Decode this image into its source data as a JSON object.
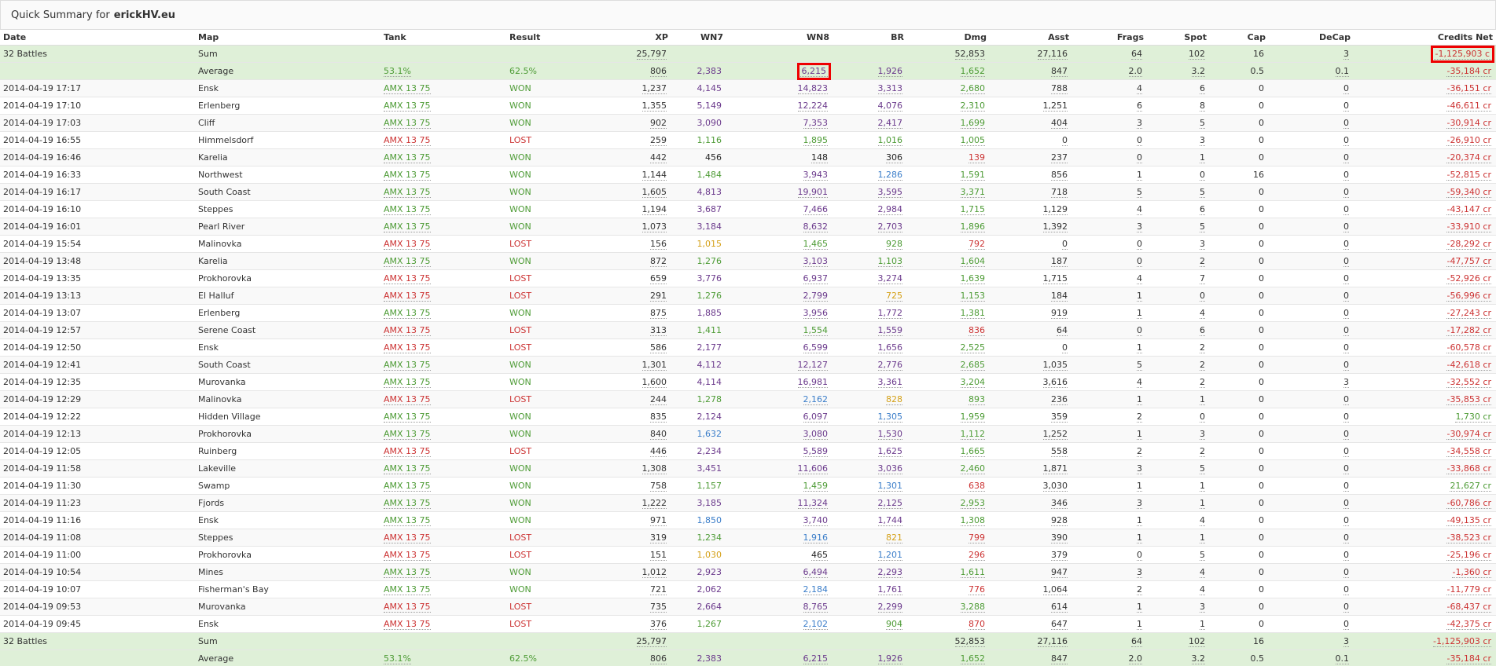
{
  "header": {
    "title_prefix": "Quick Summary for",
    "player": "erickHV.eu"
  },
  "columns": [
    "Date",
    "Map",
    "Tank",
    "Result",
    "XP",
    "WN7",
    "WN8",
    "BR",
    "Dmg",
    "Asst",
    "Frags",
    "Spot",
    "Cap",
    "DeCap",
    "Credits Net"
  ],
  "summary_top": {
    "sum": {
      "date": "32 Battles",
      "map": "Sum",
      "xp": "25,797",
      "dmg": "52,853",
      "asst": "27,116",
      "frags": "64",
      "spot": "102",
      "cap": "16",
      "decap": "3",
      "credits": "-1,125,903 c"
    },
    "avg": {
      "map": "Average",
      "tank": "53.1%",
      "result": "62.5%",
      "xp": "806",
      "wn7": "2,383",
      "wn8": "6,215",
      "br": "1,926",
      "dmg": "1,652",
      "asst": "847",
      "frags": "2.0",
      "spot": "3.2",
      "cap": "0.5",
      "decap": "0.1",
      "credits": "-35,184 cr"
    }
  },
  "summary_bottom": {
    "sum": {
      "date": "32 Battles",
      "map": "Sum",
      "xp": "25,797",
      "dmg": "52,853",
      "asst": "27,116",
      "frags": "64",
      "spot": "102",
      "cap": "16",
      "decap": "3",
      "credits": "-1,125,903 cr"
    },
    "avg": {
      "map": "Average",
      "tank": "53.1%",
      "result": "62.5%",
      "xp": "806",
      "wn7": "2,383",
      "wn8": "6,215",
      "br": "1,926",
      "dmg": "1,652",
      "asst": "847",
      "frags": "2.0",
      "spot": "3.2",
      "cap": "0.5",
      "decap": "0.1",
      "credits": "-35,184 cr"
    }
  },
  "rows": [
    {
      "date": "2014-04-19 17:17",
      "map": "Ensk",
      "tank": "AMX 13 75",
      "result": "WON",
      "xp": "1,237",
      "wn7": "4,145",
      "wn8": "14,823",
      "br": "3,313",
      "dmg": "2,680",
      "asst": "788",
      "frags": "4",
      "spot": "6",
      "cap": "0",
      "decap": "0",
      "credits": "-36,151 cr",
      "c": {
        "wn7": "purple",
        "wn8": "purple",
        "br": "purple",
        "dmg": "green",
        "credits": "red"
      }
    },
    {
      "date": "2014-04-19 17:10",
      "map": "Erlenberg",
      "tank": "AMX 13 75",
      "result": "WON",
      "xp": "1,355",
      "wn7": "5,149",
      "wn8": "12,224",
      "br": "4,076",
      "dmg": "2,310",
      "asst": "1,251",
      "frags": "6",
      "spot": "8",
      "cap": "0",
      "decap": "0",
      "credits": "-46,611 cr",
      "c": {
        "wn7": "purple",
        "wn8": "purple",
        "br": "purple",
        "dmg": "green",
        "credits": "red"
      }
    },
    {
      "date": "2014-04-19 17:03",
      "map": "Cliff",
      "tank": "AMX 13 75",
      "result": "WON",
      "xp": "902",
      "wn7": "3,090",
      "wn8": "7,353",
      "br": "2,417",
      "dmg": "1,699",
      "asst": "404",
      "frags": "3",
      "spot": "5",
      "cap": "0",
      "decap": "0",
      "credits": "-30,914 cr",
      "c": {
        "wn7": "purple",
        "wn8": "purple",
        "br": "purple",
        "dmg": "green",
        "credits": "red"
      }
    },
    {
      "date": "2014-04-19 16:55",
      "map": "Himmelsdorf",
      "tank": "AMX 13 75",
      "result": "LOST",
      "xp": "259",
      "wn7": "1,116",
      "wn8": "1,895",
      "br": "1,016",
      "dmg": "1,005",
      "asst": "0",
      "frags": "0",
      "spot": "3",
      "cap": "0",
      "decap": "0",
      "credits": "-26,910 cr",
      "c": {
        "wn7": "green",
        "wn8": "green",
        "br": "green",
        "dmg": "green",
        "credits": "red"
      }
    },
    {
      "date": "2014-04-19 16:46",
      "map": "Karelia",
      "tank": "AMX 13 75",
      "result": "WON",
      "xp": "442",
      "wn7": "456",
      "wn8": "148",
      "br": "306",
      "dmg": "139",
      "asst": "237",
      "frags": "0",
      "spot": "1",
      "cap": "0",
      "decap": "0",
      "credits": "-20,374 cr",
      "c": {
        "wn7": "black",
        "wn8": "black",
        "br": "black",
        "dmg": "red",
        "credits": "red"
      }
    },
    {
      "date": "2014-04-19 16:33",
      "map": "Northwest",
      "tank": "AMX 13 75",
      "result": "WON",
      "xp": "1,144",
      "wn7": "1,484",
      "wn8": "3,943",
      "br": "1,286",
      "dmg": "1,591",
      "asst": "856",
      "frags": "1",
      "spot": "0",
      "cap": "16",
      "decap": "0",
      "credits": "-52,815 cr",
      "c": {
        "wn7": "green",
        "wn8": "purple",
        "br": "blue",
        "dmg": "green",
        "credits": "red"
      }
    },
    {
      "date": "2014-04-19 16:17",
      "map": "South Coast",
      "tank": "AMX 13 75",
      "result": "WON",
      "xp": "1,605",
      "wn7": "4,813",
      "wn8": "19,901",
      "br": "3,595",
      "dmg": "3,371",
      "asst": "718",
      "frags": "5",
      "spot": "5",
      "cap": "0",
      "decap": "0",
      "credits": "-59,340 cr",
      "c": {
        "wn7": "purple",
        "wn8": "purple",
        "br": "purple",
        "dmg": "green",
        "credits": "red"
      }
    },
    {
      "date": "2014-04-19 16:10",
      "map": "Steppes",
      "tank": "AMX 13 75",
      "result": "WON",
      "xp": "1,194",
      "wn7": "3,687",
      "wn8": "7,466",
      "br": "2,984",
      "dmg": "1,715",
      "asst": "1,129",
      "frags": "4",
      "spot": "6",
      "cap": "0",
      "decap": "0",
      "credits": "-43,147 cr",
      "c": {
        "wn7": "purple",
        "wn8": "purple",
        "br": "purple",
        "dmg": "green",
        "credits": "red"
      }
    },
    {
      "date": "2014-04-19 16:01",
      "map": "Pearl River",
      "tank": "AMX 13 75",
      "result": "WON",
      "xp": "1,073",
      "wn7": "3,184",
      "wn8": "8,632",
      "br": "2,703",
      "dmg": "1,896",
      "asst": "1,392",
      "frags": "3",
      "spot": "5",
      "cap": "0",
      "decap": "0",
      "credits": "-33,910 cr",
      "c": {
        "wn7": "purple",
        "wn8": "purple",
        "br": "purple",
        "dmg": "green",
        "credits": "red"
      }
    },
    {
      "date": "2014-04-19 15:54",
      "map": "Malinovka",
      "tank": "AMX 13 75",
      "result": "LOST",
      "xp": "156",
      "wn7": "1,015",
      "wn8": "1,465",
      "br": "928",
      "dmg": "792",
      "asst": "0",
      "frags": "0",
      "spot": "3",
      "cap": "0",
      "decap": "0",
      "credits": "-28,292 cr",
      "c": {
        "wn7": "orange",
        "wn8": "green",
        "br": "green",
        "dmg": "red",
        "credits": "red"
      }
    },
    {
      "date": "2014-04-19 13:48",
      "map": "Karelia",
      "tank": "AMX 13 75",
      "result": "WON",
      "xp": "872",
      "wn7": "1,276",
      "wn8": "3,103",
      "br": "1,103",
      "dmg": "1,604",
      "asst": "187",
      "frags": "0",
      "spot": "2",
      "cap": "0",
      "decap": "0",
      "credits": "-47,757 cr",
      "c": {
        "wn7": "green",
        "wn8": "purple",
        "br": "green",
        "dmg": "green",
        "credits": "red"
      }
    },
    {
      "date": "2014-04-19 13:35",
      "map": "Prokhorovka",
      "tank": "AMX 13 75",
      "result": "LOST",
      "xp": "659",
      "wn7": "3,776",
      "wn8": "6,937",
      "br": "3,274",
      "dmg": "1,639",
      "asst": "1,715",
      "frags": "4",
      "spot": "7",
      "cap": "0",
      "decap": "0",
      "credits": "-52,926 cr",
      "c": {
        "wn7": "purple",
        "wn8": "purple",
        "br": "purple",
        "dmg": "green",
        "credits": "red"
      }
    },
    {
      "date": "2014-04-19 13:13",
      "map": "El Halluf",
      "tank": "AMX 13 75",
      "result": "LOST",
      "xp": "291",
      "wn7": "1,276",
      "wn8": "2,799",
      "br": "725",
      "dmg": "1,153",
      "asst": "184",
      "frags": "1",
      "spot": "0",
      "cap": "0",
      "decap": "0",
      "credits": "-56,996 cr",
      "c": {
        "wn7": "green",
        "wn8": "purple",
        "br": "orange",
        "dmg": "green",
        "credits": "red"
      }
    },
    {
      "date": "2014-04-19 13:07",
      "map": "Erlenberg",
      "tank": "AMX 13 75",
      "result": "WON",
      "xp": "875",
      "wn7": "1,885",
      "wn8": "3,956",
      "br": "1,772",
      "dmg": "1,381",
      "asst": "919",
      "frags": "1",
      "spot": "4",
      "cap": "0",
      "decap": "0",
      "credits": "-27,243 cr",
      "c": {
        "wn7": "purple",
        "wn8": "purple",
        "br": "purple",
        "dmg": "green",
        "credits": "red"
      }
    },
    {
      "date": "2014-04-19 12:57",
      "map": "Serene Coast",
      "tank": "AMX 13 75",
      "result": "LOST",
      "xp": "313",
      "wn7": "1,411",
      "wn8": "1,554",
      "br": "1,559",
      "dmg": "836",
      "asst": "64",
      "frags": "0",
      "spot": "6",
      "cap": "0",
      "decap": "0",
      "credits": "-17,282 cr",
      "c": {
        "wn7": "green",
        "wn8": "green",
        "br": "purple",
        "dmg": "red",
        "credits": "red"
      }
    },
    {
      "date": "2014-04-19 12:50",
      "map": "Ensk",
      "tank": "AMX 13 75",
      "result": "LOST",
      "xp": "586",
      "wn7": "2,177",
      "wn8": "6,599",
      "br": "1,656",
      "dmg": "2,525",
      "asst": "0",
      "frags": "1",
      "spot": "2",
      "cap": "0",
      "decap": "0",
      "credits": "-60,578 cr",
      "c": {
        "wn7": "purple",
        "wn8": "purple",
        "br": "purple",
        "dmg": "green",
        "credits": "red"
      }
    },
    {
      "date": "2014-04-19 12:41",
      "map": "South Coast",
      "tank": "AMX 13 75",
      "result": "WON",
      "xp": "1,301",
      "wn7": "4,112",
      "wn8": "12,127",
      "br": "2,776",
      "dmg": "2,685",
      "asst": "1,035",
      "frags": "5",
      "spot": "2",
      "cap": "0",
      "decap": "0",
      "credits": "-42,618 cr",
      "c": {
        "wn7": "purple",
        "wn8": "purple",
        "br": "purple",
        "dmg": "green",
        "credits": "red"
      }
    },
    {
      "date": "2014-04-19 12:35",
      "map": "Murovanka",
      "tank": "AMX 13 75",
      "result": "WON",
      "xp": "1,600",
      "wn7": "4,114",
      "wn8": "16,981",
      "br": "3,361",
      "dmg": "3,204",
      "asst": "3,616",
      "frags": "4",
      "spot": "2",
      "cap": "0",
      "decap": "3",
      "credits": "-32,552 cr",
      "c": {
        "wn7": "purple",
        "wn8": "purple",
        "br": "purple",
        "dmg": "green",
        "credits": "red"
      }
    },
    {
      "date": "2014-04-19 12:29",
      "map": "Malinovka",
      "tank": "AMX 13 75",
      "result": "LOST",
      "xp": "244",
      "wn7": "1,278",
      "wn8": "2,162",
      "br": "828",
      "dmg": "893",
      "asst": "236",
      "frags": "1",
      "spot": "1",
      "cap": "0",
      "decap": "0",
      "credits": "-35,853 cr",
      "c": {
        "wn7": "green",
        "wn8": "blue",
        "br": "orange",
        "dmg": "green",
        "credits": "red"
      }
    },
    {
      "date": "2014-04-19 12:22",
      "map": "Hidden Village",
      "tank": "AMX 13 75",
      "result": "WON",
      "xp": "835",
      "wn7": "2,124",
      "wn8": "6,097",
      "br": "1,305",
      "dmg": "1,959",
      "asst": "359",
      "frags": "2",
      "spot": "0",
      "cap": "0",
      "decap": "0",
      "credits": "1,730 cr",
      "c": {
        "wn7": "purple",
        "wn8": "purple",
        "br": "blue",
        "dmg": "green",
        "credits": "green"
      }
    },
    {
      "date": "2014-04-19 12:13",
      "map": "Prokhorovka",
      "tank": "AMX 13 75",
      "result": "WON",
      "xp": "840",
      "wn7": "1,632",
      "wn8": "3,080",
      "br": "1,530",
      "dmg": "1,112",
      "asst": "1,252",
      "frags": "1",
      "spot": "3",
      "cap": "0",
      "decap": "0",
      "credits": "-30,974 cr",
      "c": {
        "wn7": "blue",
        "wn8": "purple",
        "br": "purple",
        "dmg": "green",
        "credits": "red"
      }
    },
    {
      "date": "2014-04-19 12:05",
      "map": "Ruinberg",
      "tank": "AMX 13 75",
      "result": "LOST",
      "xp": "446",
      "wn7": "2,234",
      "wn8": "5,589",
      "br": "1,625",
      "dmg": "1,665",
      "asst": "558",
      "frags": "2",
      "spot": "2",
      "cap": "0",
      "decap": "0",
      "credits": "-34,558 cr",
      "c": {
        "wn7": "purple",
        "wn8": "purple",
        "br": "purple",
        "dmg": "green",
        "credits": "red"
      }
    },
    {
      "date": "2014-04-19 11:58",
      "map": "Lakeville",
      "tank": "AMX 13 75",
      "result": "WON",
      "xp": "1,308",
      "wn7": "3,451",
      "wn8": "11,606",
      "br": "3,036",
      "dmg": "2,460",
      "asst": "1,871",
      "frags": "3",
      "spot": "5",
      "cap": "0",
      "decap": "0",
      "credits": "-33,868 cr",
      "c": {
        "wn7": "purple",
        "wn8": "purple",
        "br": "purple",
        "dmg": "green",
        "credits": "red"
      }
    },
    {
      "date": "2014-04-19 11:30",
      "map": "Swamp",
      "tank": "AMX 13 75",
      "result": "WON",
      "xp": "758",
      "wn7": "1,157",
      "wn8": "1,459",
      "br": "1,301",
      "dmg": "638",
      "asst": "3,030",
      "frags": "1",
      "spot": "1",
      "cap": "0",
      "decap": "0",
      "credits": "21,627 cr",
      "c": {
        "wn7": "green",
        "wn8": "green",
        "br": "blue",
        "dmg": "red",
        "credits": "green"
      }
    },
    {
      "date": "2014-04-19 11:23",
      "map": "Fjords",
      "tank": "AMX 13 75",
      "result": "WON",
      "xp": "1,222",
      "wn7": "3,185",
      "wn8": "11,324",
      "br": "2,125",
      "dmg": "2,953",
      "asst": "346",
      "frags": "3",
      "spot": "1",
      "cap": "0",
      "decap": "0",
      "credits": "-60,786 cr",
      "c": {
        "wn7": "purple",
        "wn8": "purple",
        "br": "purple",
        "dmg": "green",
        "credits": "red"
      }
    },
    {
      "date": "2014-04-19 11:16",
      "map": "Ensk",
      "tank": "AMX 13 75",
      "result": "WON",
      "xp": "971",
      "wn7": "1,850",
      "wn8": "3,740",
      "br": "1,744",
      "dmg": "1,308",
      "asst": "928",
      "frags": "1",
      "spot": "4",
      "cap": "0",
      "decap": "0",
      "credits": "-49,135 cr",
      "c": {
        "wn7": "blue",
        "wn8": "purple",
        "br": "purple",
        "dmg": "green",
        "credits": "red"
      }
    },
    {
      "date": "2014-04-19 11:08",
      "map": "Steppes",
      "tank": "AMX 13 75",
      "result": "LOST",
      "xp": "319",
      "wn7": "1,234",
      "wn8": "1,916",
      "br": "821",
      "dmg": "799",
      "asst": "390",
      "frags": "1",
      "spot": "1",
      "cap": "0",
      "decap": "0",
      "credits": "-38,523 cr",
      "c": {
        "wn7": "green",
        "wn8": "blue",
        "br": "orange",
        "dmg": "red",
        "credits": "red"
      }
    },
    {
      "date": "2014-04-19 11:00",
      "map": "Prokhorovka",
      "tank": "AMX 13 75",
      "result": "LOST",
      "xp": "151",
      "wn7": "1,030",
      "wn8": "465",
      "br": "1,201",
      "dmg": "296",
      "asst": "379",
      "frags": "0",
      "spot": "5",
      "cap": "0",
      "decap": "0",
      "credits": "-25,196 cr",
      "c": {
        "wn7": "orange",
        "wn8": "black",
        "br": "blue",
        "dmg": "red",
        "credits": "red"
      }
    },
    {
      "date": "2014-04-19 10:54",
      "map": "Mines",
      "tank": "AMX 13 75",
      "result": "WON",
      "xp": "1,012",
      "wn7": "2,923",
      "wn8": "6,494",
      "br": "2,293",
      "dmg": "1,611",
      "asst": "947",
      "frags": "3",
      "spot": "4",
      "cap": "0",
      "decap": "0",
      "credits": "-1,360 cr",
      "c": {
        "wn7": "purple",
        "wn8": "purple",
        "br": "purple",
        "dmg": "green",
        "credits": "red"
      }
    },
    {
      "date": "2014-04-19 10:07",
      "map": "Fisherman's Bay",
      "tank": "AMX 13 75",
      "result": "WON",
      "xp": "721",
      "wn7": "2,062",
      "wn8": "2,184",
      "br": "1,761",
      "dmg": "776",
      "asst": "1,064",
      "frags": "2",
      "spot": "4",
      "cap": "0",
      "decap": "0",
      "credits": "-11,779 cr",
      "c": {
        "wn7": "purple",
        "wn8": "blue",
        "br": "purple",
        "dmg": "red",
        "credits": "red"
      }
    },
    {
      "date": "2014-04-19 09:53",
      "map": "Murovanka",
      "tank": "AMX 13 75",
      "result": "LOST",
      "xp": "735",
      "wn7": "2,664",
      "wn8": "8,765",
      "br": "2,299",
      "dmg": "3,288",
      "asst": "614",
      "frags": "1",
      "spot": "3",
      "cap": "0",
      "decap": "0",
      "credits": "-68,437 cr",
      "c": {
        "wn7": "purple",
        "wn8": "purple",
        "br": "purple",
        "dmg": "green",
        "credits": "red"
      }
    },
    {
      "date": "2014-04-19 09:45",
      "map": "Ensk",
      "tank": "AMX 13 75",
      "result": "LOST",
      "xp": "376",
      "wn7": "1,267",
      "wn8": "2,102",
      "br": "904",
      "dmg": "870",
      "asst": "647",
      "frags": "1",
      "spot": "1",
      "cap": "0",
      "decap": "0",
      "credits": "-42,375 cr",
      "c": {
        "wn7": "green",
        "wn8": "blue",
        "br": "green",
        "dmg": "red",
        "credits": "red"
      }
    }
  ],
  "colors": {
    "green": "#4d9b35",
    "red": "#cc3333",
    "orange": "#d4a017",
    "blue": "#3a7dc9",
    "purple": "#6b3a8c",
    "sum_bg": "#dff0d8",
    "highlight": "#ee0000"
  }
}
